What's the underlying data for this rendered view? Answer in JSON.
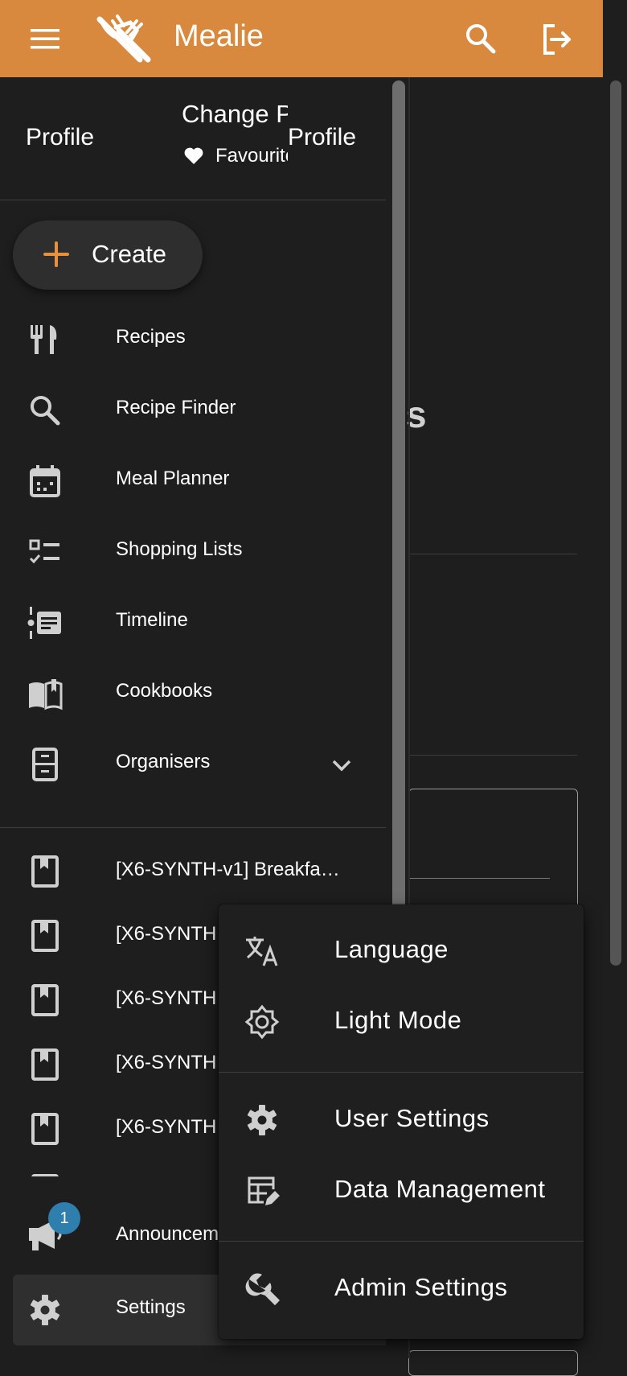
{
  "app": {
    "title": "Mealie"
  },
  "colors": {
    "accent": "#d9893d",
    "background": "#1e1e1e",
    "badge": "#2f7fae"
  },
  "header": {
    "menu_icon": "hamburger-icon",
    "search_icon": "search-icon",
    "logout_icon": "logout-icon"
  },
  "background_page": {
    "partial_heading": "s"
  },
  "drawer": {
    "profile_left": "Profile",
    "change_label": "Change P",
    "favourites_label": "Favourites",
    "profile_right": "Profile",
    "create_label": "Create",
    "nav": [
      {
        "label": "Recipes",
        "icon": "silverware-icon"
      },
      {
        "label": "Recipe Finder",
        "icon": "search-icon"
      },
      {
        "label": "Meal Planner",
        "icon": "calendar-icon"
      },
      {
        "label": "Shopping Lists",
        "icon": "checklist-icon"
      },
      {
        "label": "Timeline",
        "icon": "timeline-icon"
      },
      {
        "label": "Cookbooks",
        "icon": "book-open-icon"
      },
      {
        "label": "Organisers",
        "icon": "file-cabinet-icon"
      }
    ],
    "cookbooks": [
      {
        "label": "[X6-SYNTH-v1] Breakfa…"
      },
      {
        "label": "[X6-SYNTH"
      },
      {
        "label": "[X6-SYNTH"
      },
      {
        "label": "[X6-SYNTH"
      },
      {
        "label": "[X6-SYNTH"
      }
    ],
    "announcements_label": "Announcem",
    "announcements_badge": "1",
    "settings_label": "Settings"
  },
  "settings_menu": {
    "items": [
      {
        "label": "Language",
        "icon": "translate-icon"
      },
      {
        "label": "Light Mode",
        "icon": "brightness-icon"
      },
      {
        "label": "User Settings",
        "icon": "gear-icon"
      },
      {
        "label": "Data Management",
        "icon": "table-edit-icon"
      },
      {
        "label": "Admin Settings",
        "icon": "wrench-icon"
      }
    ]
  }
}
